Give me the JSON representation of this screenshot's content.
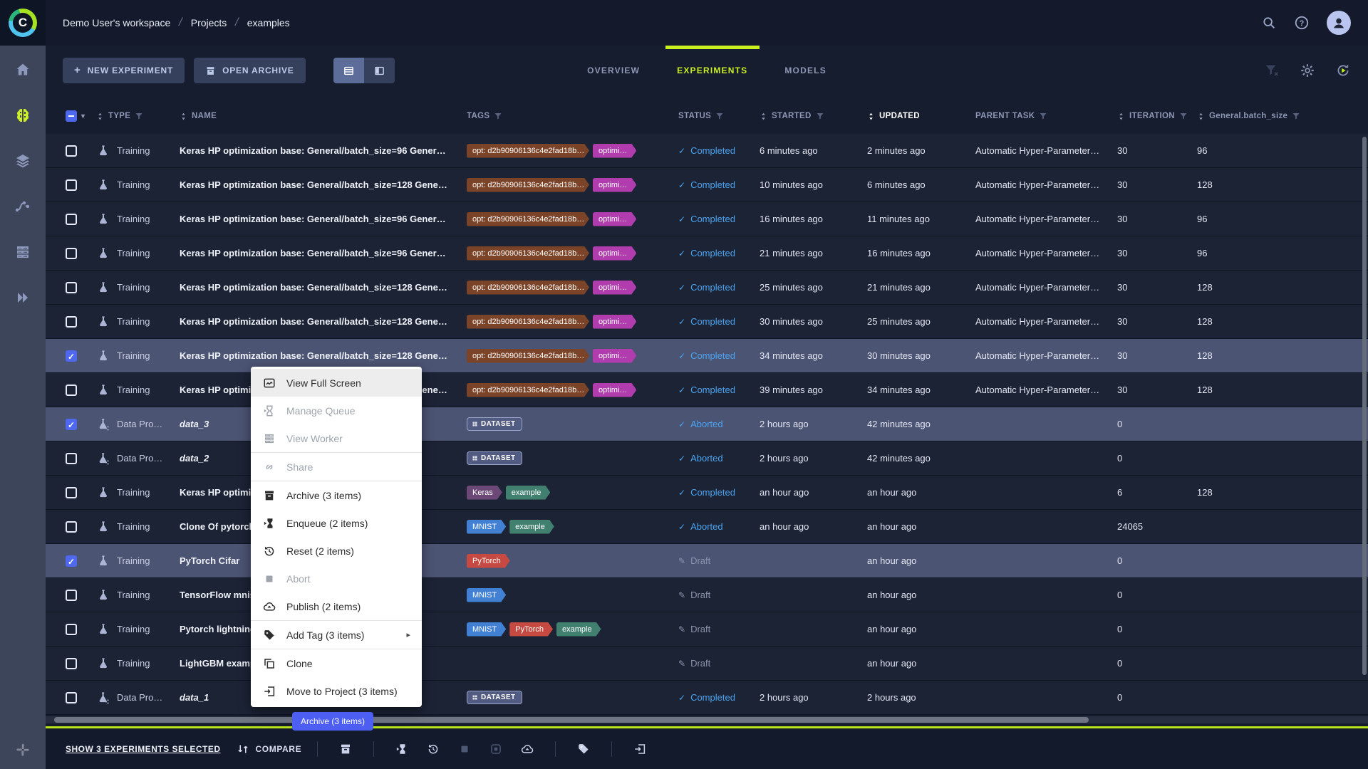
{
  "theme": {
    "accent_lime": "#c9ee22",
    "status_blue": "#4aa4f2",
    "selected_row": "#4c5474",
    "tooltip_blue": "#4c5ff2"
  },
  "header": {
    "breadcrumb": [
      "Demo User's workspace",
      "Projects",
      "examples"
    ],
    "right_icons": [
      "search-icon",
      "help-icon",
      "avatar"
    ]
  },
  "toolbar": {
    "new_experiment_label": "NEW EXPERIMENT",
    "open_archive_label": "OPEN ARCHIVE",
    "right_icons": [
      "filter-clear-icon",
      "gear-icon",
      "refresh-autorefresh-icon"
    ]
  },
  "tabs": [
    {
      "label": "OVERVIEW",
      "active": false
    },
    {
      "label": "EXPERIMENTS",
      "active": true
    },
    {
      "label": "MODELS",
      "active": false
    }
  ],
  "sidebar": {
    "items": [
      {
        "icon": "home",
        "active": false
      },
      {
        "icon": "brain",
        "active": true
      },
      {
        "icon": "layers",
        "active": false
      },
      {
        "icon": "pipeline",
        "active": false
      },
      {
        "icon": "workers",
        "active": false
      },
      {
        "icon": "apps",
        "active": false
      }
    ],
    "bottom_icon": "community"
  },
  "table": {
    "columns": [
      {
        "label": "TYPE",
        "sort": true,
        "filter": true,
        "sorted": false
      },
      {
        "label": "NAME",
        "sort": true,
        "filter": false,
        "sorted": false
      },
      {
        "label": "TAGS",
        "sort": false,
        "filter": true,
        "sorted": false
      },
      {
        "label": "STATUS",
        "sort": false,
        "filter": true,
        "sorted": false
      },
      {
        "label": "STARTED",
        "sort": true,
        "filter": true,
        "sorted": false
      },
      {
        "label": "UPDATED",
        "sort": true,
        "filter": false,
        "sorted": true
      },
      {
        "label": "PARENT TASK",
        "sort": false,
        "filter": true,
        "sorted": false
      },
      {
        "label": "ITERATION",
        "sort": true,
        "filter": true,
        "sorted": false
      },
      {
        "label": "General.batch_size",
        "sort": true,
        "filter": true,
        "sorted": false
      }
    ],
    "rows": [
      {
        "selected": false,
        "type": "Training",
        "type_icon": "training",
        "name": "Keras HP optimization base: General/batch_size=96 Gener…",
        "italic": false,
        "tags": [
          {
            "label": "opt: d2b90906136c4e2fad18b…",
            "color": "#7b4327"
          },
          {
            "label": "optimi…",
            "color": "#b13cae"
          }
        ],
        "status": {
          "label": "Completed",
          "kind": "completed"
        },
        "started": "6 minutes ago",
        "updated": "2 minutes ago",
        "parent": "Automatic Hyper-Parameter…",
        "iteration": "30",
        "batch_size": "96"
      },
      {
        "selected": false,
        "type": "Training",
        "type_icon": "training",
        "name": "Keras HP optimization base: General/batch_size=128 Gene…",
        "italic": false,
        "tags": [
          {
            "label": "opt: d2b90906136c4e2fad18b…",
            "color": "#7b4327"
          },
          {
            "label": "optimi…",
            "color": "#b13cae"
          }
        ],
        "status": {
          "label": "Completed",
          "kind": "completed"
        },
        "started": "10 minutes ago",
        "updated": "6 minutes ago",
        "parent": "Automatic Hyper-Parameter…",
        "iteration": "30",
        "batch_size": "128"
      },
      {
        "selected": false,
        "type": "Training",
        "type_icon": "training",
        "name": "Keras HP optimization base: General/batch_size=96 Gener…",
        "italic": false,
        "tags": [
          {
            "label": "opt: d2b90906136c4e2fad18b…",
            "color": "#7b4327"
          },
          {
            "label": "optimi…",
            "color": "#b13cae"
          }
        ],
        "status": {
          "label": "Completed",
          "kind": "completed"
        },
        "started": "16 minutes ago",
        "updated": "11 minutes ago",
        "parent": "Automatic Hyper-Parameter…",
        "iteration": "30",
        "batch_size": "96"
      },
      {
        "selected": false,
        "type": "Training",
        "type_icon": "training",
        "name": "Keras HP optimization base: General/batch_size=96 Gener…",
        "italic": false,
        "tags": [
          {
            "label": "opt: d2b90906136c4e2fad18b…",
            "color": "#7b4327"
          },
          {
            "label": "optimi…",
            "color": "#b13cae"
          }
        ],
        "status": {
          "label": "Completed",
          "kind": "completed"
        },
        "started": "21 minutes ago",
        "updated": "16 minutes ago",
        "parent": "Automatic Hyper-Parameter…",
        "iteration": "30",
        "batch_size": "96"
      },
      {
        "selected": false,
        "type": "Training",
        "type_icon": "training",
        "name": "Keras HP optimization base: General/batch_size=128 Gene…",
        "italic": false,
        "tags": [
          {
            "label": "opt: d2b90906136c4e2fad18b…",
            "color": "#7b4327"
          },
          {
            "label": "optimi…",
            "color": "#b13cae"
          }
        ],
        "status": {
          "label": "Completed",
          "kind": "completed"
        },
        "started": "25 minutes ago",
        "updated": "21 minutes ago",
        "parent": "Automatic Hyper-Parameter…",
        "iteration": "30",
        "batch_size": "128"
      },
      {
        "selected": false,
        "type": "Training",
        "type_icon": "training",
        "name": "Keras HP optimization base: General/batch_size=128 Gene…",
        "italic": false,
        "tags": [
          {
            "label": "opt: d2b90906136c4e2fad18b…",
            "color": "#7b4327"
          },
          {
            "label": "optimi…",
            "color": "#b13cae"
          }
        ],
        "status": {
          "label": "Completed",
          "kind": "completed"
        },
        "started": "30 minutes ago",
        "updated": "25 minutes ago",
        "parent": "Automatic Hyper-Parameter…",
        "iteration": "30",
        "batch_size": "128"
      },
      {
        "selected": true,
        "type": "Training",
        "type_icon": "training",
        "name": "Keras HP optimization base: General/batch_size=128 Gene…",
        "italic": false,
        "tags": [
          {
            "label": "opt: d2b90906136c4e2fad18b…",
            "color": "#7b4327"
          },
          {
            "label": "optimi…",
            "color": "#b13cae"
          }
        ],
        "status": {
          "label": "Completed",
          "kind": "completed"
        },
        "started": "34 minutes ago",
        "updated": "30 minutes ago",
        "parent": "Automatic Hyper-Parameter…",
        "iteration": "30",
        "batch_size": "128"
      },
      {
        "selected": false,
        "type": "Training",
        "type_icon": "training",
        "name": "Keras HP optimization base: General/batch_size=128 Gene…",
        "italic": false,
        "tags": [
          {
            "label": "opt: d2b90906136c4e2fad18b…",
            "color": "#7b4327"
          },
          {
            "label": "optimi…",
            "color": "#b13cae"
          }
        ],
        "status": {
          "label": "Completed",
          "kind": "completed"
        },
        "started": "39 minutes ago",
        "updated": "34 minutes ago",
        "parent": "Automatic Hyper-Parameter…",
        "iteration": "30",
        "batch_size": "128"
      },
      {
        "selected": true,
        "type": "Data Pro…",
        "type_icon": "data",
        "name": "data_3",
        "italic": true,
        "tags": [
          {
            "label": "DATASET",
            "outline": true,
            "color": "#525c82",
            "icon": "dataset"
          }
        ],
        "status": {
          "label": "Aborted",
          "kind": "aborted"
        },
        "started": "2 hours ago",
        "updated": "42 minutes ago",
        "parent": "",
        "iteration": "0",
        "batch_size": ""
      },
      {
        "selected": false,
        "type": "Data Pro…",
        "type_icon": "data",
        "name": "data_2",
        "italic": true,
        "tags": [
          {
            "label": "DATASET",
            "outline": true,
            "color": "#525c82",
            "icon": "dataset"
          }
        ],
        "status": {
          "label": "Aborted",
          "kind": "aborted"
        },
        "started": "2 hours ago",
        "updated": "42 minutes ago",
        "parent": "",
        "iteration": "0",
        "batch_size": ""
      },
      {
        "selected": false,
        "type": "Training",
        "type_icon": "training",
        "name": "Keras HP optimization base",
        "italic": false,
        "tags": [
          {
            "label": "Keras",
            "color": "#6b4876"
          },
          {
            "label": "example",
            "color": "#41806e"
          }
        ],
        "status": {
          "label": "Completed",
          "kind": "completed"
        },
        "started": "an hour ago",
        "updated": "an hour ago",
        "parent": "",
        "iteration": "6",
        "batch_size": "128"
      },
      {
        "selected": false,
        "type": "Training",
        "type_icon": "training",
        "name": "Clone Of pytorch",
        "italic": false,
        "tags": [
          {
            "label": "MNIST",
            "color": "#4280d4"
          },
          {
            "label": "example",
            "color": "#41806e"
          }
        ],
        "status": {
          "label": "Aborted",
          "kind": "aborted"
        },
        "started": "an hour ago",
        "updated": "an hour ago",
        "parent": "",
        "iteration": "24065",
        "batch_size": ""
      },
      {
        "selected": true,
        "type": "Training",
        "type_icon": "training",
        "name": "PyTorch Cifar",
        "italic": false,
        "tags": [
          {
            "label": "PyTorch",
            "color": "#c64a42"
          }
        ],
        "status": {
          "label": "Draft",
          "kind": "draft"
        },
        "started": "",
        "updated": "an hour ago",
        "parent": "",
        "iteration": "0",
        "batch_size": ""
      },
      {
        "selected": false,
        "type": "Training",
        "type_icon": "training",
        "name": "TensorFlow mnist",
        "italic": false,
        "tags": [
          {
            "label": "MNIST",
            "color": "#4280d4"
          }
        ],
        "status": {
          "label": "Draft",
          "kind": "draft"
        },
        "started": "",
        "updated": "an hour ago",
        "parent": "",
        "iteration": "0",
        "batch_size": ""
      },
      {
        "selected": false,
        "type": "Training",
        "type_icon": "training",
        "name": "Pytorch lightning example",
        "italic": false,
        "tags": [
          {
            "label": "MNIST",
            "color": "#4280d4"
          },
          {
            "label": "PyTorch",
            "color": "#c64a42"
          },
          {
            "label": "example",
            "color": "#41806e"
          }
        ],
        "status": {
          "label": "Draft",
          "kind": "draft"
        },
        "started": "",
        "updated": "an hour ago",
        "parent": "",
        "iteration": "0",
        "batch_size": ""
      },
      {
        "selected": false,
        "type": "Training",
        "type_icon": "training",
        "name": "LightGBM example",
        "italic": false,
        "tags": [],
        "status": {
          "label": "Draft",
          "kind": "draft"
        },
        "started": "",
        "updated": "an hour ago",
        "parent": "",
        "iteration": "0",
        "batch_size": ""
      },
      {
        "selected": false,
        "type": "Data Pro…",
        "type_icon": "data",
        "name": "data_1",
        "italic": true,
        "tags": [
          {
            "label": "DATASET",
            "outline": true,
            "color": "#525c82",
            "icon": "dataset"
          }
        ],
        "status": {
          "label": "Completed",
          "kind": "completed"
        },
        "started": "2 hours ago",
        "updated": "2 hours ago",
        "parent": "",
        "iteration": "0",
        "batch_size": ""
      }
    ]
  },
  "context_menu": {
    "items": [
      {
        "icon": "fullscreen",
        "label": "View Full Screen",
        "enabled": true,
        "hover": true
      },
      {
        "icon": "queue",
        "label": "Manage Queue",
        "enabled": false
      },
      {
        "icon": "worker",
        "label": "View Worker",
        "enabled": false
      },
      {
        "sep": true
      },
      {
        "icon": "share",
        "label": "Share",
        "enabled": false
      },
      {
        "sep": true
      },
      {
        "icon": "archive",
        "label": "Archive (3 items)",
        "enabled": true
      },
      {
        "icon": "enqueue",
        "label": "Enqueue (2 items)",
        "enabled": true
      },
      {
        "icon": "reset",
        "label": "Reset (2 items)",
        "enabled": true
      },
      {
        "icon": "abort",
        "label": "Abort",
        "enabled": false
      },
      {
        "icon": "publish",
        "label": "Publish (2 items)",
        "enabled": true
      },
      {
        "sep": true
      },
      {
        "icon": "tag",
        "label": "Add Tag (3 items)",
        "enabled": true,
        "submenu": true
      },
      {
        "sep": true
      },
      {
        "icon": "clone",
        "label": "Clone",
        "enabled": true
      },
      {
        "icon": "move",
        "label": "Move to Project (3 items)",
        "enabled": true
      }
    ]
  },
  "tooltip": {
    "label": "Archive (3 items)"
  },
  "footer": {
    "show_selected_label": "SHOW 3 EXPERIMENTS SELECTED",
    "compare_label": "COMPARE",
    "action_groups": [
      [
        {
          "icon": "archive",
          "enabled": true
        }
      ],
      [
        {
          "icon": "enqueue",
          "enabled": true
        },
        {
          "icon": "reset",
          "enabled": true
        },
        {
          "icon": "abort",
          "enabled": false
        },
        {
          "icon": "abort-all",
          "enabled": false
        },
        {
          "icon": "publish",
          "enabled": true
        }
      ],
      [
        {
          "icon": "tag",
          "enabled": true
        }
      ],
      [
        {
          "icon": "move",
          "enabled": true
        }
      ]
    ]
  }
}
